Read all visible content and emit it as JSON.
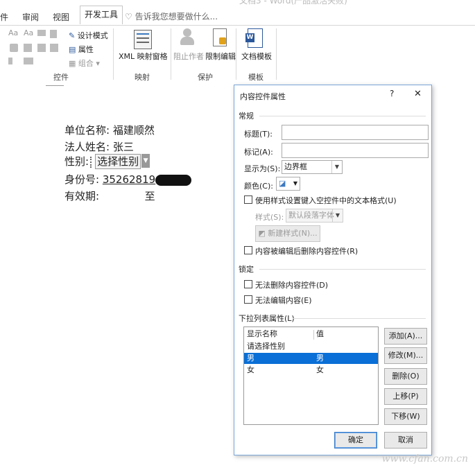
{
  "title_partial": "文档3 - Word(产品激活失败)",
  "tabs": [
    {
      "label": "件"
    },
    {
      "label": "审阅"
    },
    {
      "label": "视图"
    },
    {
      "label": "开发工具",
      "active": true
    }
  ],
  "tell_me": "告诉我您想要做什么...",
  "ribbon": {
    "controls": {
      "design_mode": "设计模式",
      "properties": "属性",
      "group": "组合",
      "label": "控件"
    },
    "mapping": {
      "xml_pane": "XML 映射窗格",
      "label": "映射"
    },
    "protect": {
      "block_authors": "阻止作者",
      "restrict_editing": "限制编辑",
      "label": "保护"
    },
    "templates": {
      "doc_template": "文档模板",
      "label": "模板"
    }
  },
  "document": {
    "line1_label": "单位名称:",
    "line1_value": "福建顺然",
    "line2_label": "法人姓名:",
    "line2_value": "张三",
    "line3_label": "性别:",
    "line3_control": "选择性别",
    "line4_label": "身份号:",
    "line4_value": "35262819",
    "line5_label": "有效期:",
    "line5_to": "至"
  },
  "dialog": {
    "title": "内容控件属性",
    "help": "?",
    "close": "✕",
    "general_section": "常规",
    "title_label": "标题(T):",
    "tag_label": "标记(A):",
    "show_as_label": "显示为(S):",
    "show_as_value": "边界框",
    "color_label": "颜色(C):",
    "use_style_label": "使用样式设置键入空控件中的文本格式(U)",
    "style_label": "样式(S):",
    "style_value": "默认段落字体",
    "new_style_button": "新建样式(N)...",
    "delete_on_edit_label": "内容被编辑后删除内容控件(R)",
    "locking_section": "锁定",
    "no_delete_label": "无法删除内容控件(D)",
    "no_edit_label": "无法编辑内容(E)",
    "dropdown_section": "下拉列表属性(L)",
    "list_header": {
      "name": "显示名称",
      "value": "值"
    },
    "list_items": [
      {
        "name": "请选择性别",
        "value": ""
      },
      {
        "name": "男",
        "value": "男",
        "selected": true
      },
      {
        "name": "女",
        "value": "女"
      }
    ],
    "buttons": {
      "add": "添加(A)...",
      "modify": "修改(M)...",
      "delete": "删除(O)",
      "move_up": "上移(P)",
      "move_down": "下移(W)",
      "ok": "确定",
      "cancel": "取消"
    }
  },
  "watermark": "www.cfan.com.cn",
  "colors": {
    "accent": "#0a6fd6",
    "tab_active": "#2b579a"
  }
}
